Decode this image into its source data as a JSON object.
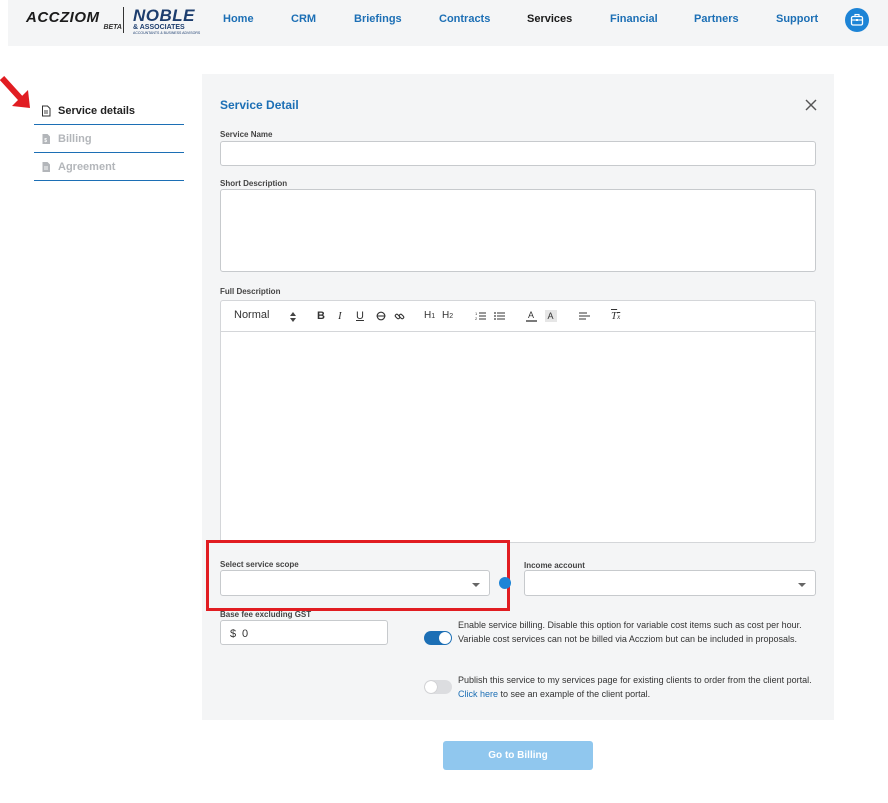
{
  "brand": {
    "accziom": "ACCZIOM",
    "beta": "BETA",
    "noble": "NOBLE",
    "noble_sub": "& ASSOCIATES",
    "noble_tag": "ACCOUNTANTS & BUSINESS ADVISORS"
  },
  "nav": {
    "items": [
      "Home",
      "CRM",
      "Briefings",
      "Contracts",
      "Services",
      "Financial",
      "Partners",
      "Support"
    ],
    "active": "Services"
  },
  "sidebar": {
    "items": [
      {
        "label": "Service details",
        "state": "active",
        "icon": "document-icon"
      },
      {
        "label": "Billing",
        "state": "disabled",
        "icon": "invoice-icon"
      },
      {
        "label": "Agreement",
        "state": "disabled",
        "icon": "agreement-icon"
      }
    ]
  },
  "form": {
    "title": "Service Detail",
    "service_name_label": "Service Name",
    "service_name_value": "",
    "short_desc_label": "Short Description",
    "short_desc_value": "",
    "full_desc_label": "Full Description",
    "editor": {
      "style_select": "Normal",
      "buttons": [
        "B",
        "I",
        "U",
        "S",
        "link",
        "H1",
        "H2",
        "ol",
        "ul",
        "A",
        "A-bg",
        "align",
        "Tx"
      ]
    },
    "scope_label": "Select service scope",
    "scope_value": "",
    "income_label": "Income account",
    "income_value": "",
    "fee_label": "Base fee excluding GST",
    "fee_prefix": "$",
    "fee_value": "0",
    "billing_toggle": {
      "on": true,
      "text": "Enable service billing. Disable this option for variable cost items such as cost per hour. Variable cost services can not be billed via Accziom but can be included in proposals."
    },
    "publish_toggle": {
      "on": false,
      "text_before": "Publish this service to my services page for existing clients to order from the client portal.",
      "link": "Click here",
      "text_after": "to see an example of the client portal."
    },
    "submit_label": "Go to Billing"
  },
  "colors": {
    "accent": "#1c6fb5",
    "highlight": "#e11d22",
    "button_disabled": "#90c7ee"
  }
}
